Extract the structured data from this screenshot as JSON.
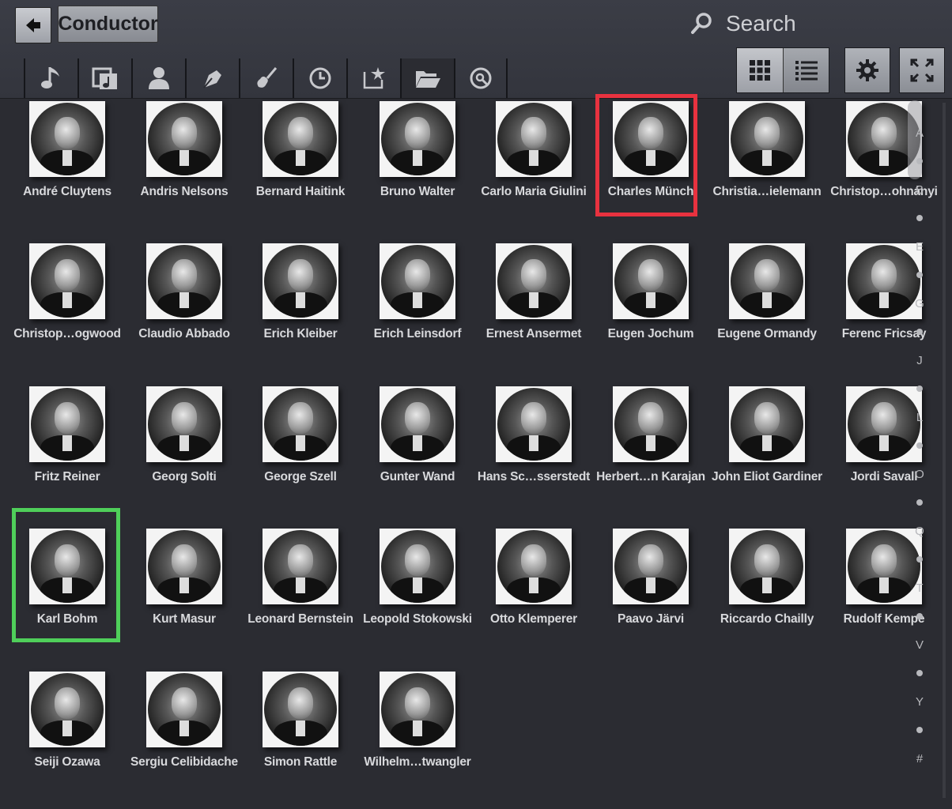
{
  "header": {
    "back_icon": "arrow-left-icon",
    "breadcrumb": "Conductor",
    "search_placeholder": "Search",
    "tabs": [
      {
        "icon": "music-note-icon"
      },
      {
        "icon": "albums-icon"
      },
      {
        "icon": "person-icon"
      },
      {
        "icon": "composer-pen-icon"
      },
      {
        "icon": "guitar-icon"
      },
      {
        "icon": "clock-icon"
      },
      {
        "icon": "star-folder-icon"
      },
      {
        "icon": "folder-open-icon",
        "active": true
      },
      {
        "icon": "disc-search-icon"
      }
    ],
    "view_mode": "grid"
  },
  "conductors": [
    "André Cluytens",
    "Andris Nelsons",
    "Bernard Haitink",
    "Bruno Walter",
    "Carlo Maria Giulini",
    "Charles Münch",
    "Christia…ielemann",
    "Christop…ohnányi",
    "Christop…ogwood",
    "Claudio Abbado",
    "Erich Kleiber",
    "Erich Leinsdorf",
    "Ernest Ansermet",
    "Eugen Jochum",
    "Eugene Ormandy",
    "Ferenc Fricsay",
    "Fritz Reiner",
    "Georg Solti",
    "George Szell",
    "Gunter Wand",
    "Hans Sc…sserstedt",
    "Herbert…n Karajan",
    "John Eliot Gardiner",
    "Jordi Savall",
    "Karl Bohm",
    "Kurt Masur",
    "Leonard Bernstein",
    "Leopold Stokowski",
    "Otto Klemperer",
    "Paavo Järvi",
    "Riccardo Chailly",
    "Rudolf Kempe",
    "Seiji Ozawa",
    "Sergiu Celibidache",
    "Simon Rattle",
    "Wilhelm…twangler"
  ],
  "highlights": {
    "red": "Charles Münch",
    "green": "Karl Bohm"
  },
  "colors": {
    "red_highlight": "#e8323f",
    "green_highlight": "#4fcf5a",
    "background": "#2b2c32"
  },
  "index": [
    "A",
    "•",
    "B",
    "•",
    "E",
    "•",
    "G",
    "•",
    "J",
    "•",
    "L",
    "•",
    "O",
    "•",
    "Q",
    "•",
    "T",
    "•",
    "V",
    "•",
    "Y",
    "•",
    "#"
  ]
}
